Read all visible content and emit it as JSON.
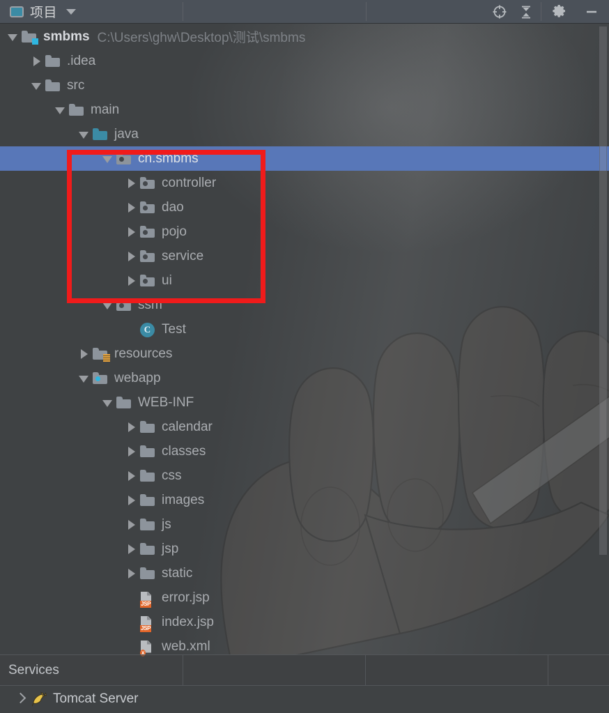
{
  "window": {
    "title": "项目",
    "tab_icon": "project-panel-icon",
    "dropdown_icon": "chevron-down-icon",
    "toolbar": [
      {
        "name": "locate-in-tree-button",
        "icon": "crosshair-icon",
        "tooltip": "Select Opened File"
      },
      {
        "name": "collapse-all-button",
        "icon": "collapse-all-icon",
        "tooltip": "Collapse All"
      },
      {
        "name": "settings-button",
        "icon": "gear-icon",
        "tooltip": "Settings"
      },
      {
        "name": "hide-button",
        "icon": "minimize-icon",
        "tooltip": "Hide"
      }
    ]
  },
  "colors": {
    "accent_selection": "#5877b8",
    "annotation_red": "#f01b1b",
    "source_root": "#3b8ba5",
    "badge_orange": "#e2662a",
    "header_bg": "#4b5159",
    "panel_bg": "#3f4244"
  },
  "tree": {
    "rows": [
      {
        "indent": 0,
        "twisty": "expanded",
        "icon": "folder-module-icon",
        "label": "smbms",
        "bold": true,
        "path": "C:\\Users\\ghw\\Desktop\\测试\\smbms",
        "selected": false
      },
      {
        "indent": 1,
        "twisty": "collapsed",
        "icon": "folder-icon",
        "label": ".idea",
        "bold": false,
        "path": "",
        "selected": false
      },
      {
        "indent": 1,
        "twisty": "expanded",
        "icon": "folder-icon",
        "label": "src",
        "bold": false,
        "path": "",
        "selected": false
      },
      {
        "indent": 2,
        "twisty": "expanded",
        "icon": "folder-icon",
        "label": "main",
        "bold": false,
        "path": "",
        "selected": false
      },
      {
        "indent": 3,
        "twisty": "expanded",
        "icon": "folder-source-root-icon",
        "label": "java",
        "bold": false,
        "path": "",
        "selected": false
      },
      {
        "indent": 4,
        "twisty": "expanded",
        "icon": "package-icon",
        "label": "cn.smbms",
        "bold": false,
        "path": "",
        "selected": true
      },
      {
        "indent": 5,
        "twisty": "collapsed",
        "icon": "package-icon",
        "label": "controller",
        "bold": false,
        "path": "",
        "selected": false
      },
      {
        "indent": 5,
        "twisty": "collapsed",
        "icon": "package-icon",
        "label": "dao",
        "bold": false,
        "path": "",
        "selected": false
      },
      {
        "indent": 5,
        "twisty": "collapsed",
        "icon": "package-icon",
        "label": "pojo",
        "bold": false,
        "path": "",
        "selected": false
      },
      {
        "indent": 5,
        "twisty": "collapsed",
        "icon": "package-icon",
        "label": "service",
        "bold": false,
        "path": "",
        "selected": false
      },
      {
        "indent": 5,
        "twisty": "collapsed",
        "icon": "package-icon",
        "label": "ui",
        "bold": false,
        "path": "",
        "selected": false
      },
      {
        "indent": 4,
        "twisty": "expanded",
        "icon": "package-icon",
        "label": "ssm",
        "bold": false,
        "path": "",
        "selected": false
      },
      {
        "indent": 5,
        "twisty": "none",
        "icon": "java-class-icon",
        "label": "Test",
        "bold": false,
        "path": "",
        "selected": false
      },
      {
        "indent": 3,
        "twisty": "collapsed",
        "icon": "folder-resources-icon",
        "label": "resources",
        "bold": false,
        "path": "",
        "selected": false
      },
      {
        "indent": 3,
        "twisty": "expanded",
        "icon": "folder-webapp-icon",
        "label": "webapp",
        "bold": false,
        "path": "",
        "selected": false
      },
      {
        "indent": 4,
        "twisty": "expanded",
        "icon": "folder-icon",
        "label": "WEB-INF",
        "bold": false,
        "path": "",
        "selected": false
      },
      {
        "indent": 5,
        "twisty": "collapsed",
        "icon": "folder-icon",
        "label": "calendar",
        "bold": false,
        "path": "",
        "selected": false
      },
      {
        "indent": 5,
        "twisty": "collapsed",
        "icon": "folder-icon",
        "label": "classes",
        "bold": false,
        "path": "",
        "selected": false
      },
      {
        "indent": 5,
        "twisty": "collapsed",
        "icon": "folder-icon",
        "label": "css",
        "bold": false,
        "path": "",
        "selected": false
      },
      {
        "indent": 5,
        "twisty": "collapsed",
        "icon": "folder-icon",
        "label": "images",
        "bold": false,
        "path": "",
        "selected": false
      },
      {
        "indent": 5,
        "twisty": "collapsed",
        "icon": "folder-icon",
        "label": "js",
        "bold": false,
        "path": "",
        "selected": false
      },
      {
        "indent": 5,
        "twisty": "collapsed",
        "icon": "folder-icon",
        "label": "jsp",
        "bold": false,
        "path": "",
        "selected": false
      },
      {
        "indent": 5,
        "twisty": "collapsed",
        "icon": "folder-icon",
        "label": "static",
        "bold": false,
        "path": "",
        "selected": false
      },
      {
        "indent": 5,
        "twisty": "none",
        "icon": "jsp-file-icon",
        "label": "error.jsp",
        "bold": false,
        "path": "",
        "selected": false
      },
      {
        "indent": 5,
        "twisty": "none",
        "icon": "jsp-file-icon",
        "label": "index.jsp",
        "bold": false,
        "path": "",
        "selected": false
      },
      {
        "indent": 5,
        "twisty": "none",
        "icon": "xml-file-icon",
        "label": "web.xml",
        "bold": false,
        "path": "",
        "selected": false
      }
    ]
  },
  "annotation": {
    "shape": "rectangle",
    "color": "#f01b1b",
    "encloses": [
      "cn.smbms",
      "controller",
      "dao",
      "pojo",
      "service",
      "ui"
    ]
  },
  "services": {
    "title": "Services",
    "items": [
      {
        "label": "Tomcat Server",
        "icon": "tomcat-cat-icon",
        "twisty": "collapsed"
      }
    ]
  }
}
